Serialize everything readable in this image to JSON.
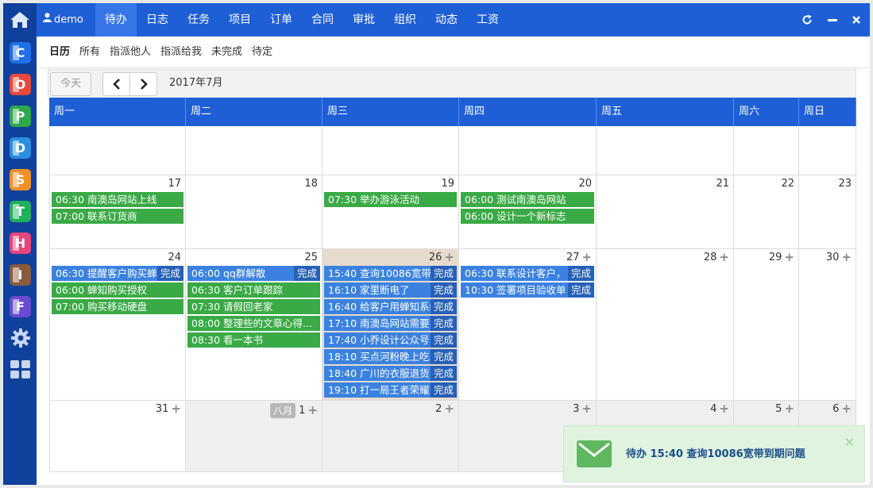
{
  "user": {
    "name": "demo"
  },
  "nav": {
    "tabs": [
      {
        "label": "待办",
        "active": true
      },
      {
        "label": "日志"
      },
      {
        "label": "任务"
      },
      {
        "label": "项目"
      },
      {
        "label": "订单"
      },
      {
        "label": "合同"
      },
      {
        "label": "审批"
      },
      {
        "label": "组织"
      },
      {
        "label": "动态"
      },
      {
        "label": "工资"
      }
    ]
  },
  "sidebar": {
    "apps": [
      {
        "letter": "C",
        "color": "#1e6fe8"
      },
      {
        "letter": "O",
        "color": "#e84a3a"
      },
      {
        "letter": "P",
        "color": "#2ea84a"
      },
      {
        "letter": "D",
        "color": "#2a8de0"
      },
      {
        "letter": "S",
        "color": "#f0902a"
      },
      {
        "letter": "T",
        "color": "#20b05a"
      },
      {
        "letter": "H",
        "color": "#e8457a"
      },
      {
        "letter": "I",
        "color": "#8a5a3a"
      },
      {
        "letter": "F",
        "color": "#6a4ad0"
      }
    ]
  },
  "subnav": {
    "tabs": [
      {
        "label": "日历",
        "active": true
      },
      {
        "label": "所有"
      },
      {
        "label": "指派他人"
      },
      {
        "label": "指派给我"
      },
      {
        "label": "未完成"
      },
      {
        "label": "待定"
      }
    ]
  },
  "toolbar": {
    "today_label": "今天",
    "month_title": "2017年7月"
  },
  "calendar": {
    "weekdays": [
      "周一",
      "周二",
      "周三",
      "周四",
      "周五",
      "周六",
      "周日"
    ],
    "weeks": [
      {
        "days": [
          {
            "num": ""
          },
          {
            "num": ""
          },
          {
            "num": ""
          },
          {
            "num": ""
          },
          {
            "num": ""
          },
          {
            "num": ""
          },
          {
            "num": ""
          }
        ]
      },
      {
        "days": [
          {
            "num": "17",
            "events": [
              {
                "text": "06:30 南澳岛网站上线",
                "color": "green"
              },
              {
                "text": "07:00 联系订货商",
                "color": "green"
              }
            ]
          },
          {
            "num": "18"
          },
          {
            "num": "19",
            "events": [
              {
                "text": "07:30 举办游泳活动",
                "color": "green"
              }
            ]
          },
          {
            "num": "20",
            "events": [
              {
                "text": "06:00 测试南澳岛网站",
                "color": "green"
              },
              {
                "text": "06:00 设计一个新标志",
                "color": "green"
              }
            ]
          },
          {
            "num": "21"
          },
          {
            "num": "22"
          },
          {
            "num": "23"
          }
        ]
      },
      {
        "days": [
          {
            "num": "24",
            "events": [
              {
                "text": "06:30 提醒客户购买蝉",
                "color": "blue",
                "done": "完成"
              },
              {
                "text": "06:00 蝉知购买授权",
                "color": "green"
              },
              {
                "text": "07:00 购买移动硬盘",
                "color": "green"
              }
            ]
          },
          {
            "num": "25",
            "events": [
              {
                "text": "06:00 qq群解散",
                "color": "blue",
                "done": "完成"
              },
              {
                "text": "06:30 客户订单跟踪",
                "color": "green"
              },
              {
                "text": "07:30 请假回老家",
                "color": "green"
              },
              {
                "text": "08:00 整理些的文章心得...",
                "color": "green"
              },
              {
                "text": "08:30 看一本书",
                "color": "green"
              }
            ]
          },
          {
            "num": "26",
            "plus": true,
            "today": true,
            "events": [
              {
                "text": "15:40 查询10086宽带...",
                "color": "blue",
                "done": "完成"
              },
              {
                "text": "16:10 家里断电了",
                "color": "blue",
                "done": "完成"
              },
              {
                "text": "16:40 给客户用蝉知系统",
                "color": "blue",
                "done": "完成"
              },
              {
                "text": "17:10 南澳岛网站需要...",
                "color": "blue",
                "done": "完成"
              },
              {
                "text": "17:40 小乔设计公众号",
                "color": "blue",
                "done": "完成"
              },
              {
                "text": "18:10 买点河粉晚上吃",
                "color": "blue",
                "done": "完成"
              },
              {
                "text": "18:40 广川的衣服退货",
                "color": "blue",
                "done": "完成"
              },
              {
                "text": "19:10 打一局王者荣耀",
                "color": "blue",
                "done": "完成"
              }
            ]
          },
          {
            "num": "27",
            "plus": true,
            "events": [
              {
                "text": "06:30 联系设计客户，",
                "color": "blue",
                "done": "完成"
              },
              {
                "text": "10:30 签署项目验收单",
                "color": "blue",
                "done": "完成"
              }
            ]
          },
          {
            "num": "28",
            "plus": true
          },
          {
            "num": "29",
            "plus": true
          },
          {
            "num": "30",
            "plus": true
          }
        ]
      },
      {
        "days": [
          {
            "num": "31",
            "plus": true
          },
          {
            "num": "1",
            "plus": true,
            "other": true,
            "badge": "八月"
          },
          {
            "num": "2",
            "plus": true,
            "other": true
          },
          {
            "num": "3",
            "plus": true,
            "other": true
          },
          {
            "num": "4",
            "plus": true,
            "other": true
          },
          {
            "num": "5",
            "plus": true,
            "other": true
          },
          {
            "num": "6",
            "plus": true,
            "other": true
          }
        ]
      }
    ]
  },
  "toast": {
    "text": "待办 15:40 查询10086宽带到期问题",
    "close": "×"
  }
}
